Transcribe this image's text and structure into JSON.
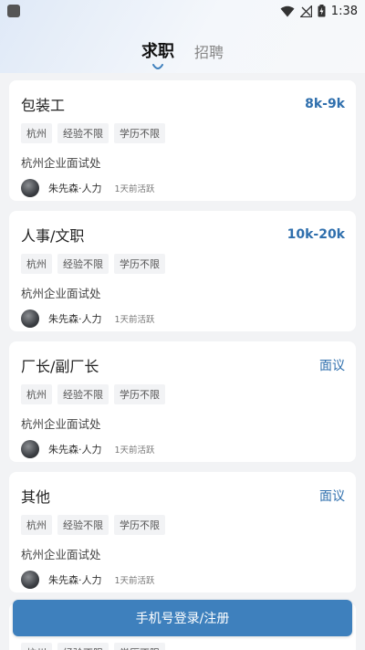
{
  "status_bar": {
    "time": "1:38"
  },
  "tabs": [
    {
      "label": "求职",
      "active": true
    },
    {
      "label": "招聘",
      "active": false
    }
  ],
  "jobs": [
    {
      "title": "包装工",
      "salary": "8k-9k",
      "tags": [
        "杭州",
        "经验不限",
        "学历不限"
      ],
      "company": "杭州企业面试处",
      "recruiter": "朱先森·人力",
      "active": "1天前活跃"
    },
    {
      "title": "人事/文职",
      "salary": "10k-20k",
      "tags": [
        "杭州",
        "经验不限",
        "学历不限"
      ],
      "company": "杭州企业面试处",
      "recruiter": "朱先森·人力",
      "active": "1天前活跃"
    },
    {
      "title": "厂长/副厂长",
      "salary": "面议",
      "tags": [
        "杭州",
        "经验不限",
        "学历不限"
      ],
      "company": "杭州企业面试处",
      "recruiter": "朱先森·人力",
      "active": "1天前活跃"
    },
    {
      "title": "其他",
      "salary": "面议",
      "tags": [
        "杭州",
        "经验不限",
        "学历不限"
      ],
      "company": "杭州企业面试处",
      "recruiter": "朱先森·人力",
      "active": "1天前活跃"
    }
  ],
  "partial_tags": [
    "杭州",
    "经验不限",
    "学历不限"
  ],
  "login_button": "手机号登录/注册",
  "colors": {
    "accent": "#3e80bd",
    "salary": "#2f6fad"
  }
}
